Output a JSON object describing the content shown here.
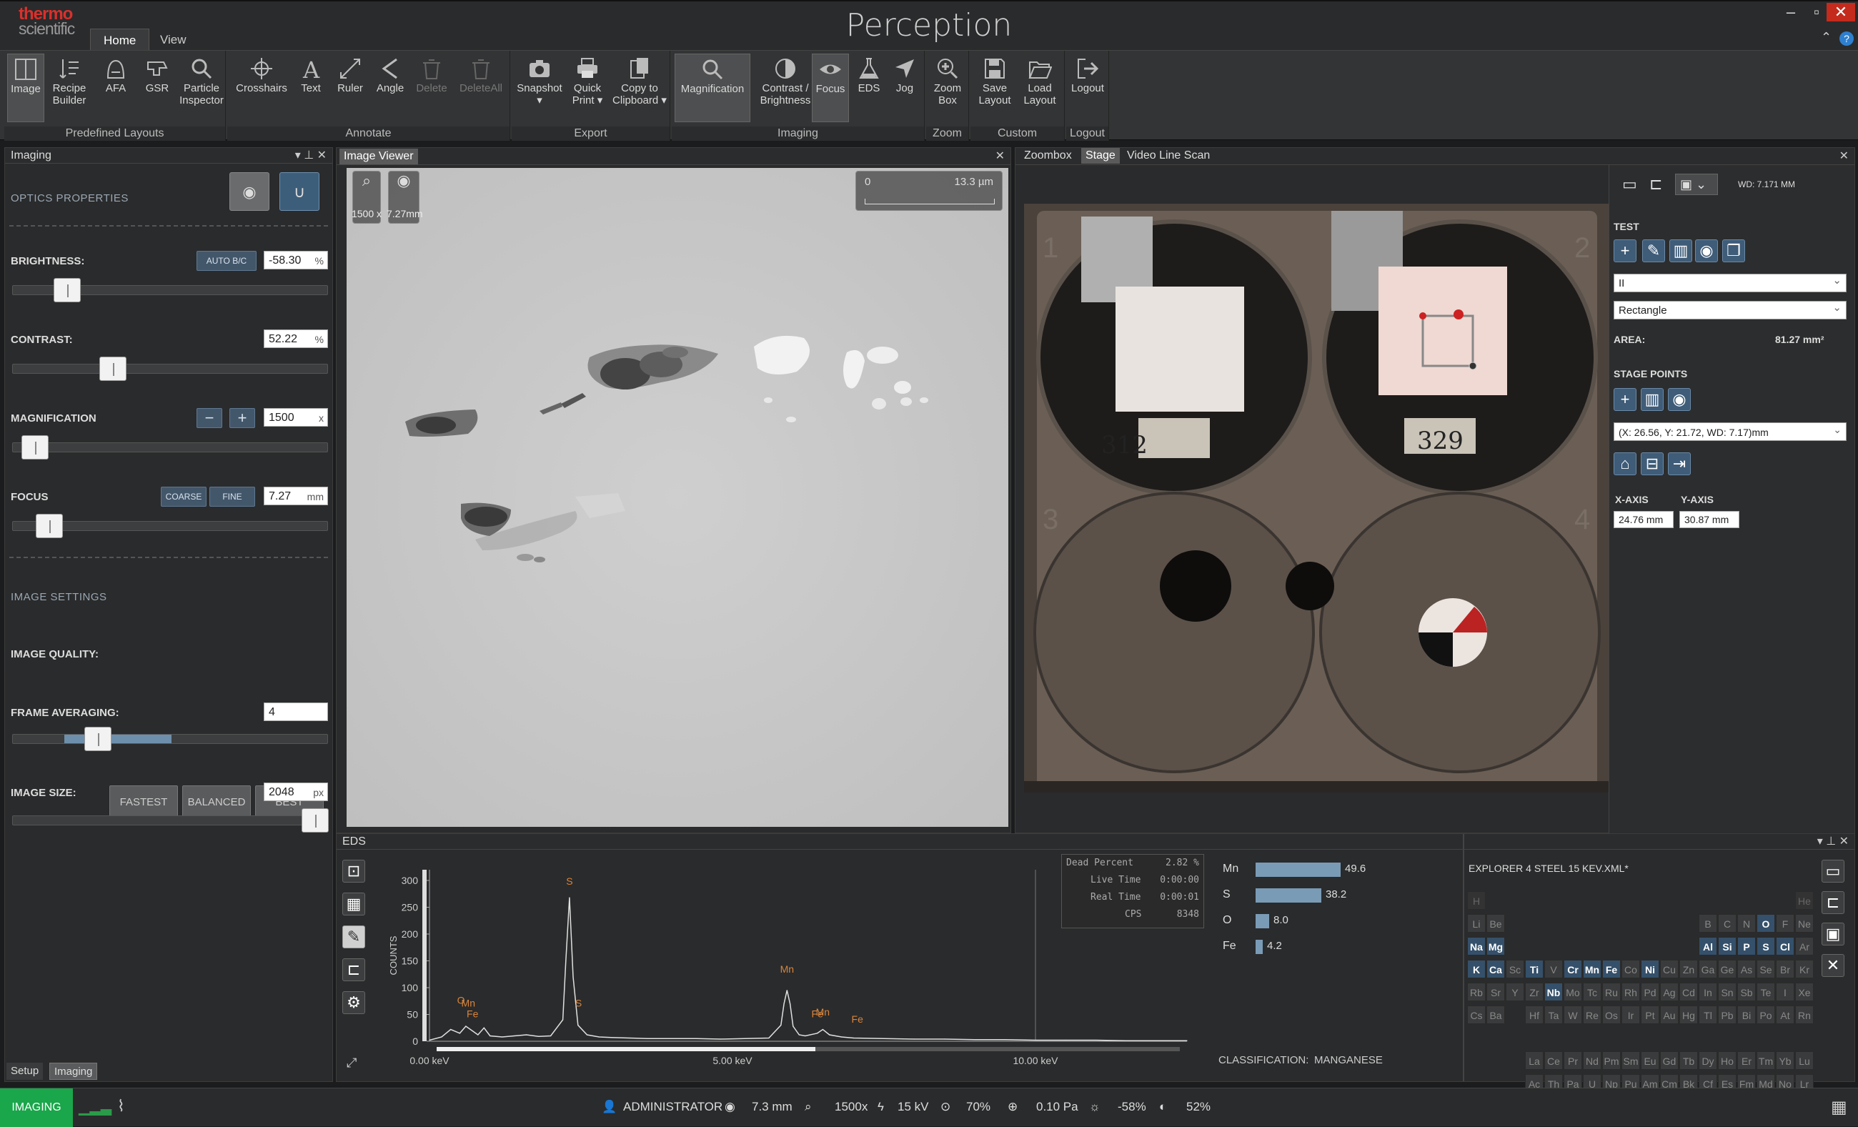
{
  "app": {
    "logo_line1": "thermo",
    "logo_line2": "scientific",
    "title": "Perception",
    "tabs": [
      "Home",
      "View"
    ],
    "active_tab": "Home"
  },
  "ribbon": {
    "groups": [
      {
        "label": "Predefined Layouts",
        "buttons": [
          "Image",
          "Recipe Builder",
          "AFA",
          "GSR",
          "Particle Inspector"
        ]
      },
      {
        "label": "Annotate",
        "buttons": [
          "Crosshairs",
          "Text",
          "Ruler",
          "Angle",
          "Delete",
          "DeleteAll"
        ]
      },
      {
        "label": "Export",
        "buttons": [
          "Snapshot",
          "Quick Print",
          "Copy to Clipboard"
        ]
      },
      {
        "label": "Imaging",
        "buttons": [
          "Magnification",
          "Contrast / Brightness",
          "Focus",
          "EDS",
          "Jog"
        ]
      },
      {
        "label": "Zoom",
        "buttons": [
          "Zoom Box"
        ]
      },
      {
        "label": "Custom",
        "buttons": [
          "Save Layout",
          "Load Layout"
        ]
      },
      {
        "label": "Logout",
        "buttons": [
          "Logout"
        ]
      }
    ]
  },
  "imaging_panel": {
    "title": "Imaging",
    "optics_heading": "OPTICS PROPERTIES",
    "brightness": {
      "label": "BRIGHTNESS:",
      "auto_label": "AUTO B/C",
      "value": "-58.30",
      "unit": "%",
      "level": 0.14
    },
    "contrast": {
      "label": "CONTRAST:",
      "value": "52.22",
      "unit": "%",
      "level": 0.3
    },
    "magnification": {
      "label": "MAGNIFICATION",
      "value": "1500",
      "unit": "x",
      "level": 0.03
    },
    "focus": {
      "label": "FOCUS",
      "coarse": "COARSE",
      "fine": "FINE",
      "value": "7.27",
      "unit": "mm",
      "level": 0.08
    },
    "image_settings_heading": "IMAGE SETTINGS",
    "quality": {
      "label": "IMAGE QUALITY:",
      "options": [
        "FASTEST",
        "BALANCED",
        "BEST"
      ]
    },
    "frame_averaging": {
      "label": "FRAME AVERAGING:",
      "value": "4"
    },
    "image_size": {
      "label": "IMAGE SIZE:",
      "value": "2048",
      "unit": "px"
    },
    "bottom_tabs": [
      "Setup",
      "Imaging"
    ]
  },
  "image_viewer": {
    "title": "Image Viewer",
    "mag_readout": "1500 x",
    "wd_readout": "7.27mm",
    "scale_start": "0",
    "scale_end": "13.3 µm"
  },
  "stage_panel": {
    "tabs": [
      "Zoombox",
      "Stage",
      "Video Line Scan"
    ],
    "active_tab": "Stage",
    "wd": "WD: 7.171 MM",
    "test_heading": "TEST",
    "dropdown1": "II",
    "shape": "Rectangle",
    "area_label": "AREA:",
    "area_value": "81.27 mm²",
    "stage_points_heading": "STAGE POINTS",
    "point": "(X: 26.56, Y: 21.72, WD: 7.17)mm",
    "x_axis_label": "X-AXIS",
    "y_axis_label": "Y-AXIS",
    "x_axis_value": "24.76 mm",
    "y_axis_value": "30.87 mm",
    "sample_labels": [
      "312",
      "329"
    ],
    "quadrant_numbers": [
      "1",
      "2",
      "3",
      "4"
    ]
  },
  "eds_panel": {
    "title": "EDS",
    "stats": [
      {
        "label": "Dead Percent",
        "value": "2.82 %"
      },
      {
        "label": "Live Time",
        "value": "0:00:00"
      },
      {
        "label": "Real Time",
        "value": "0:00:01"
      },
      {
        "label": "CPS",
        "value": "8348"
      }
    ],
    "composition": [
      {
        "element": "Mn",
        "value": "49.6"
      },
      {
        "element": "S",
        "value": "38.2"
      },
      {
        "element": "O",
        "value": "8.0"
      },
      {
        "element": "Fe",
        "value": "4.2"
      }
    ],
    "classification_label": "CLASSIFICATION:",
    "classification_value": "MANGANESE",
    "recipe_file": "EXPLORER 4 STEEL 15 KEV.XML*"
  },
  "chart_data": {
    "type": "line",
    "ylabel": "COUNTS",
    "xlabel": "",
    "yticks": [
      0,
      50,
      100,
      150,
      200,
      250,
      300
    ],
    "xticks": [
      "0.00 keV",
      "5.00 keV",
      "10.00 keV"
    ],
    "xlim": [
      0,
      12.5
    ],
    "ylim": [
      0,
      320
    ],
    "series": [
      {
        "x": [
          0.0,
          0.2,
          0.35,
          0.5,
          0.6,
          0.7,
          0.8,
          0.9,
          1.0,
          1.2,
          1.4,
          1.6,
          1.8,
          2.0,
          2.2,
          2.25,
          2.31,
          2.37,
          2.45,
          2.6,
          2.8,
          3.0,
          3.3,
          3.6,
          4.0,
          4.4,
          4.8,
          5.2,
          5.6,
          5.8,
          5.85,
          5.9,
          5.95,
          6.0,
          6.1,
          6.2,
          6.4,
          6.49,
          6.6,
          6.8,
          7.0,
          7.5,
          8.0,
          8.5,
          9.0,
          9.5,
          10.0,
          10.5,
          11.0,
          11.5,
          12.0,
          12.5
        ],
        "y": [
          2,
          8,
          22,
          15,
          28,
          20,
          12,
          25,
          10,
          8,
          10,
          12,
          9,
          10,
          40,
          150,
          268,
          120,
          30,
          12,
          8,
          7,
          6,
          5,
          5,
          5,
          4,
          5,
          6,
          30,
          70,
          95,
          70,
          28,
          12,
          10,
          15,
          22,
          12,
          8,
          6,
          5,
          4,
          4,
          3,
          3,
          2,
          2,
          2,
          1,
          1,
          1
        ]
      }
    ],
    "peak_labels": [
      {
        "label": "O",
        "x": 0.52,
        "y": 70
      },
      {
        "label": "Mn",
        "x": 0.64,
        "y": 65
      },
      {
        "label": "Fe",
        "x": 0.71,
        "y": 45
      },
      {
        "label": "S",
        "x": 2.31,
        "y": 292
      },
      {
        "label": "S",
        "x": 2.46,
        "y": 65
      },
      {
        "label": "Mn",
        "x": 5.9,
        "y": 128
      },
      {
        "label": "Mn",
        "x": 6.49,
        "y": 48
      },
      {
        "label": "Fe",
        "x": 6.4,
        "y": 45
      },
      {
        "label": "Fe",
        "x": 7.06,
        "y": 35
      }
    ]
  },
  "periodic_table": {
    "active": [
      "K",
      "Ca",
      "Ti",
      "Cr",
      "Mn",
      "Fe",
      "Ni",
      "Nb",
      "Na",
      "Mg",
      "Al",
      "Si",
      "P",
      "S",
      "Cl",
      "O"
    ],
    "rows": [
      [
        "H",
        "",
        "",
        "",
        "",
        "",
        "",
        "",
        "",
        "",
        "",
        "",
        "",
        "",
        "",
        "",
        "",
        "He"
      ],
      [
        "Li",
        "Be",
        "",
        "",
        "",
        "",
        "",
        "",
        "",
        "",
        "",
        "",
        "B",
        "C",
        "N",
        "O",
        "F",
        "Ne"
      ],
      [
        "Na",
        "Mg",
        "",
        "",
        "",
        "",
        "",
        "",
        "",
        "",
        "",
        "",
        "Al",
        "Si",
        "P",
        "S",
        "Cl",
        "Ar"
      ],
      [
        "K",
        "Ca",
        "Sc",
        "Ti",
        "V",
        "Cr",
        "Mn",
        "Fe",
        "Co",
        "Ni",
        "Cu",
        "Zn",
        "Ga",
        "Ge",
        "As",
        "Se",
        "Br",
        "Kr"
      ],
      [
        "Rb",
        "Sr",
        "Y",
        "Zr",
        "Nb",
        "Mo",
        "Tc",
        "Ru",
        "Rh",
        "Pd",
        "Ag",
        "Cd",
        "In",
        "Sn",
        "Sb",
        "Te",
        "I",
        "Xe"
      ],
      [
        "Cs",
        "Ba",
        "",
        "Hf",
        "Ta",
        "W",
        "Re",
        "Os",
        "Ir",
        "Pt",
        "Au",
        "Hg",
        "Tl",
        "Pb",
        "Bi",
        "Po",
        "At",
        "Rn"
      ],
      [],
      [
        "",
        "",
        "",
        "La",
        "Ce",
        "Pr",
        "Nd",
        "Pm",
        "Sm",
        "Eu",
        "Gd",
        "Tb",
        "Dy",
        "Ho",
        "Er",
        "Tm",
        "Yb",
        "Lu"
      ],
      [
        "",
        "",
        "",
        "Ac",
        "Th",
        "Pa",
        "U",
        "Np",
        "Pu",
        "Am",
        "Cm",
        "Bk",
        "Cf",
        "Es",
        "Fm",
        "Md",
        "No",
        "Lr"
      ]
    ]
  },
  "status": {
    "mode": "IMAGING",
    "user": "ADMINISTRATOR",
    "wd": "7.3 mm",
    "mag": "1500x",
    "kv": "15 kV",
    "spot": "70%",
    "vacuum": "0.10 Pa",
    "brightness": "-58%",
    "contrast": "52%"
  }
}
